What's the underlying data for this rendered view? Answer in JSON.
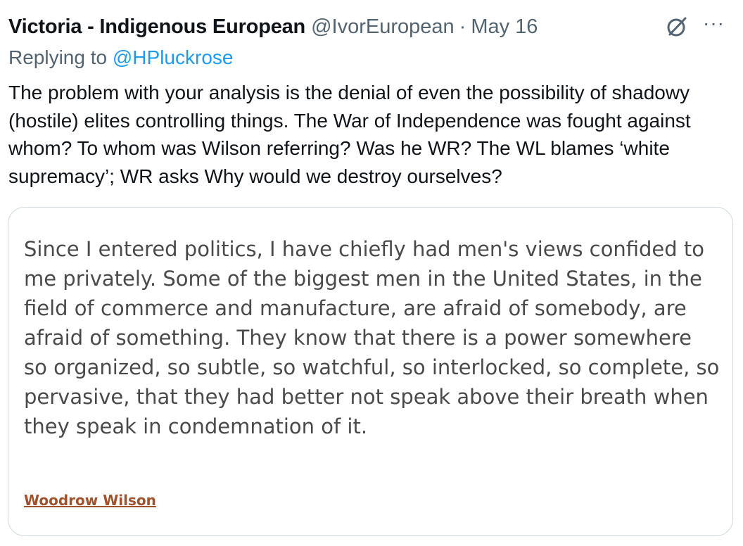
{
  "tweet": {
    "author": {
      "display_name": "Victoria - Indigenous European",
      "handle": "@IvorEuropean"
    },
    "separator": "·",
    "date": "May 16",
    "reply": {
      "prefix": "Replying to",
      "mention": "@HPluckrose"
    },
    "text": "The problem with your analysis is the denial of even the possibility of shadowy (hostile) elites controlling things. The War of Independence was fought against whom? To whom was Wilson referring? Was he WR? The WL blames ‘white supremacy’; WR asks Why would we destroy ourselves?",
    "actions": {
      "grok_icon": "grok-icon",
      "more_label": "···"
    },
    "quote_card": {
      "text": "Since I entered politics, I have chiefly had men's views confided to me privately. Some of the biggest men in the United States, in the field of commerce and manufacture, are afraid of somebody, are afraid of something. They know that there is a power somewhere so organized, so subtle, so watchful, so interlocked, so complete, so pervasive, that they had better not speak above their breath when they speak in condemnation of it.",
      "author": "Woodrow Wilson"
    }
  },
  "colors": {
    "primary_text": "#0f1419",
    "secondary_text": "#536471",
    "link": "#1d9bf0",
    "card_border": "#cfd9de",
    "quote_text": "#4a4a4a",
    "quote_author": "#a0522d"
  }
}
